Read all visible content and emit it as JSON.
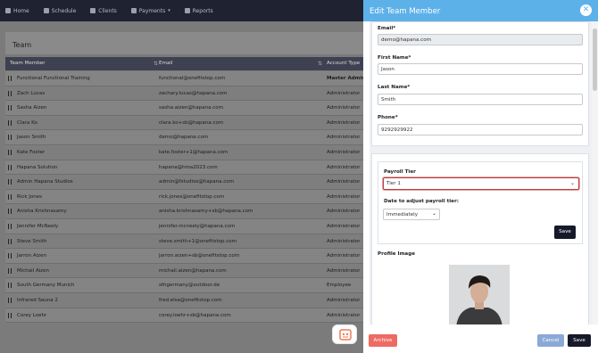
{
  "nav": {
    "items": [
      "Home",
      "Schedule",
      "Clients",
      "Payments",
      "Reports"
    ],
    "icons": [
      "home-icon",
      "calendar-icon",
      "users-icon",
      "payments-icon",
      "reports-icon"
    ]
  },
  "page": {
    "title": "Team",
    "columns": [
      "Team Member",
      "Email",
      "Account Type"
    ],
    "rows": [
      {
        "name": "Functional Functional Training",
        "email": "functional@onefitstop.com",
        "type": "Master Admin"
      },
      {
        "name": "Zach Lucas",
        "email": "zachary.lucas@hapana.com",
        "type": "Administrator"
      },
      {
        "name": "Sasha Aizen",
        "email": "sasha.aizen@hapana.com",
        "type": "Administrator"
      },
      {
        "name": "Clara Ko",
        "email": "clara.ko+sb@hapana.com",
        "type": "Administrator"
      },
      {
        "name": "Jason Smith",
        "email": "demo@hapana.com",
        "type": "Administrator"
      },
      {
        "name": "Kate Foster",
        "email": "kate.foster+1@hapana.com",
        "type": "Administrator"
      },
      {
        "name": "Hapana Solution",
        "email": "hapana@hma2023.com",
        "type": "Administrator"
      },
      {
        "name": "Admin Hapana Studios",
        "email": "admin@fstudios@hapana.com",
        "type": "Administrator"
      },
      {
        "name": "Rick Jones",
        "email": "rick.jones@onefitstop.com",
        "type": "Administrator"
      },
      {
        "name": "Anisha Krishnasamy",
        "email": "anisha.krishnasamy+sb@hapana.com",
        "type": "Administrator"
      },
      {
        "name": "Jennifer McNeely",
        "email": "jennifer.mcneely@hapana.com",
        "type": "Administrator"
      },
      {
        "name": "Steve Smith",
        "email": "steve.smith+1@onefitstop.com",
        "type": "Administrator"
      },
      {
        "name": "Jarron Aizen",
        "email": "jarron.aizen+sb@onefitstop.com",
        "type": "Administrator"
      },
      {
        "name": "Michail Aizen",
        "email": "michail.aizen@hapana.com",
        "type": "Administrator"
      },
      {
        "name": "South Germany Munich",
        "email": "sthgermany@outdoor.de",
        "type": "Employee"
      },
      {
        "name": "Infrared Sauna 2",
        "email": "fred.elsa@onefitstop.com",
        "type": "Administrator"
      },
      {
        "name": "Corey Loehr",
        "email": "corey.loehr+sb@hapana.com",
        "type": "Administrator"
      }
    ]
  },
  "modal": {
    "title": "Edit Team Member",
    "close_icon": "close-icon",
    "email_label": "Email*",
    "email_value": "demo@hapana.com",
    "first_name_label": "First Name*",
    "first_name_value": "Jason",
    "last_name_label": "Last Name*",
    "last_name_value": "Smith",
    "phone_label": "Phone*",
    "phone_value": "9292929922",
    "payroll_tier_label": "Payroll Tier",
    "payroll_tier_value": "Tier 1",
    "date_label": "Date to adjust payroll tier:",
    "date_value": "Immediately",
    "save_inner_label": "Save",
    "profile_image_label": "Profile Image",
    "archive_label": "Archive",
    "cancel_label": "Cancel",
    "save_label": "Save"
  },
  "colors": {
    "modal_header": "#5db1e9",
    "archive": "#ee6b63",
    "cancel": "#8ba9d6",
    "save": "#16192a",
    "highlight": "#b83c3f"
  }
}
